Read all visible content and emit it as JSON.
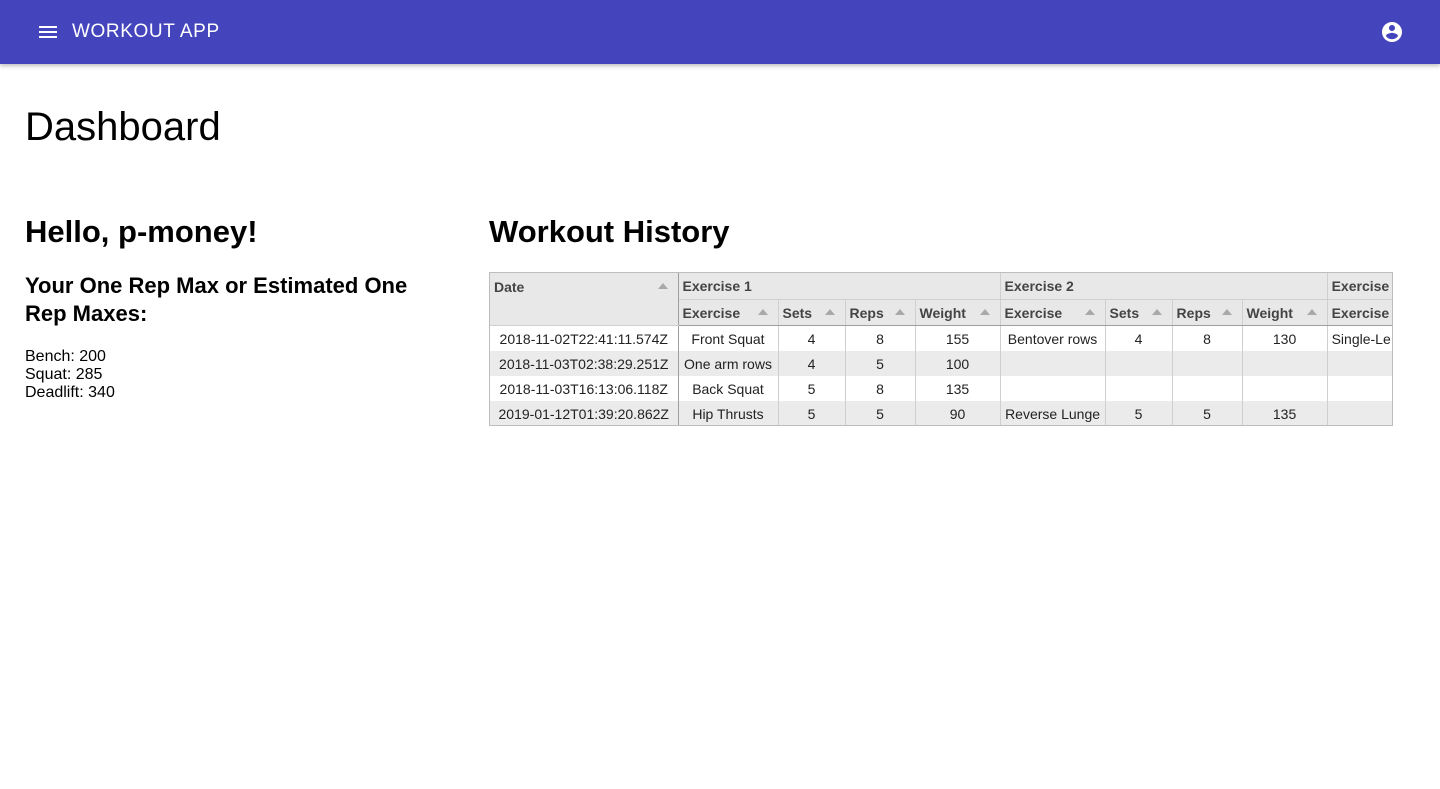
{
  "app": {
    "title": "WORKOUT APP",
    "theme_color": "#4444bd",
    "menu_icon": "menu-icon",
    "account_icon": "account-circle-icon"
  },
  "page": {
    "title": "Dashboard"
  },
  "profile": {
    "greeting": "Hello, p-money!",
    "orm_heading": "Your One Rep Max or Estimated One Rep Maxes:",
    "maxes": [
      "Bench: 200",
      "Squat: 285",
      "Deadlift: 340"
    ]
  },
  "history": {
    "title": "Workout History",
    "date_header": "Date",
    "groups": [
      "Exercise 1",
      "Exercise 2",
      "Exercise"
    ],
    "sub_headers": [
      "Exercise",
      "Sets",
      "Reps",
      "Weight",
      "Exercise",
      "Sets",
      "Reps",
      "Weight",
      "Exercise"
    ],
    "rows": [
      [
        "2018-11-02T22:41:11.574Z",
        "Front Squat",
        "4",
        "8",
        "155",
        "Bentover rows",
        "4",
        "8",
        "130",
        "Single-Le"
      ],
      [
        "2018-11-03T02:38:29.251Z",
        "One arm rows",
        "4",
        "5",
        "100",
        "",
        "",
        "",
        "",
        ""
      ],
      [
        "2018-11-03T16:13:06.118Z",
        "Back Squat",
        "5",
        "8",
        "135",
        "",
        "",
        "",
        "",
        ""
      ],
      [
        "2019-01-12T01:39:20.862Z",
        "Hip Thrusts",
        "5",
        "5",
        "90",
        "Reverse Lunge",
        "5",
        "5",
        "135",
        ""
      ]
    ]
  }
}
